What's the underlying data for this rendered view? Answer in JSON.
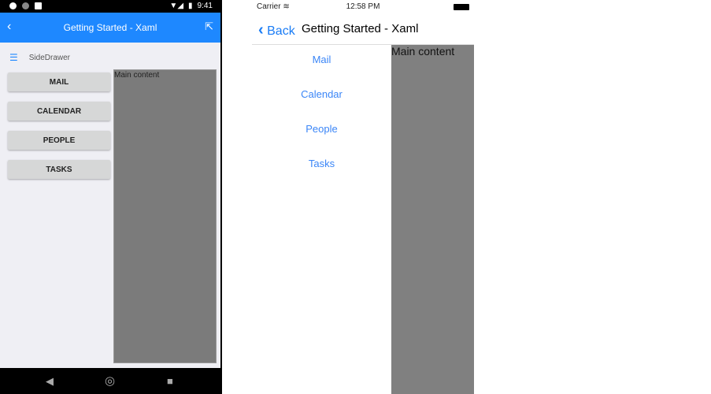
{
  "android": {
    "status_time": "9:41",
    "title": "Getting Started - Xaml",
    "drawer_title": "SideDrawer",
    "buttons": [
      "MAIL",
      "CALENDAR",
      "PEOPLE",
      "TASKS"
    ],
    "main_content": "Main content",
    "accent": "#1e88ff"
  },
  "ios": {
    "carrier": "Carrier",
    "time": "12:58 PM",
    "back": "Back",
    "title": "Getting Started - Xaml",
    "items": [
      "Mail",
      "Calendar",
      "People",
      "Tasks"
    ],
    "main_content": "Main content",
    "accent": "#3b86f7"
  }
}
